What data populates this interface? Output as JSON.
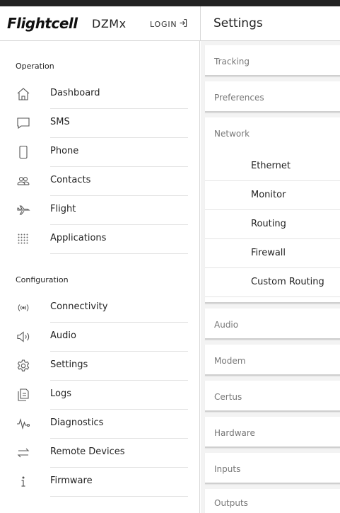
{
  "header": {
    "brand": "Flightcell",
    "product": "DZMx",
    "login_label": "LOGIN",
    "page_title": "Settings"
  },
  "sidebar": {
    "operation_title": "Operation",
    "operation_items": [
      {
        "label": "Dashboard",
        "icon": "home-icon"
      },
      {
        "label": "SMS",
        "icon": "message-icon"
      },
      {
        "label": "Phone",
        "icon": "phone-icon"
      },
      {
        "label": "Contacts",
        "icon": "contacts-icon"
      },
      {
        "label": "Flight",
        "icon": "airplane-icon"
      },
      {
        "label": "Applications",
        "icon": "apps-grid-icon"
      }
    ],
    "configuration_title": "Configuration",
    "configuration_items": [
      {
        "label": "Connectivity",
        "icon": "signal-icon"
      },
      {
        "label": "Audio",
        "icon": "speaker-icon"
      },
      {
        "label": "Settings",
        "icon": "gear-icon"
      },
      {
        "label": "Logs",
        "icon": "logs-icon"
      },
      {
        "label": "Diagnostics",
        "icon": "pulse-icon"
      },
      {
        "label": "Remote Devices",
        "icon": "swap-arrows-icon"
      },
      {
        "label": "Firmware",
        "icon": "info-icon"
      }
    ]
  },
  "settings_panel": {
    "sections": [
      "Tracking",
      "Preferences",
      "Network",
      "Audio",
      "Modem",
      "Certus",
      "Hardware",
      "Inputs",
      "Outputs"
    ],
    "network_items": [
      "Ethernet",
      "Monitor",
      "Routing",
      "Firewall",
      "Custom Routing"
    ]
  },
  "colors": {
    "top_border": "#222222",
    "panel_background": "#f3f3f3",
    "section_title_text": "#777777"
  }
}
